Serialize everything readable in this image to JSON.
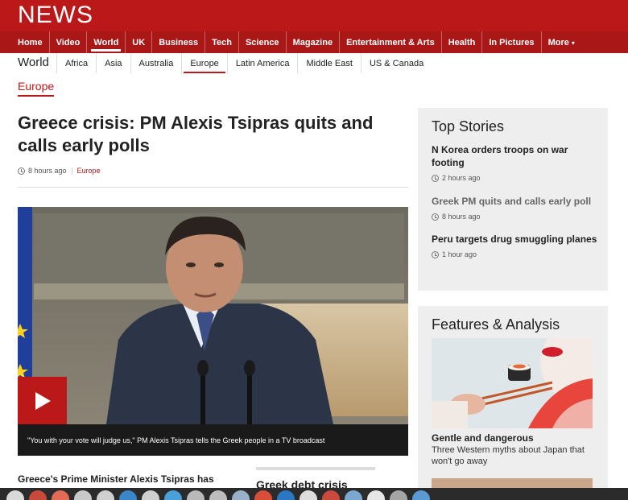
{
  "brand": {
    "logo_text": "NEWS",
    "accent": "#bb1919"
  },
  "main_nav": [
    {
      "label": "Home"
    },
    {
      "label": "Video"
    },
    {
      "label": "World",
      "active": true
    },
    {
      "label": "UK"
    },
    {
      "label": "Business"
    },
    {
      "label": "Tech"
    },
    {
      "label": "Science"
    },
    {
      "label": "Magazine"
    },
    {
      "label": "Entertainment & Arts"
    },
    {
      "label": "Health"
    },
    {
      "label": "In Pictures"
    },
    {
      "label": "More"
    }
  ],
  "sub_nav": {
    "section": "World",
    "items": [
      {
        "label": "Africa"
      },
      {
        "label": "Asia"
      },
      {
        "label": "Australia"
      },
      {
        "label": "Europe",
        "active": true
      },
      {
        "label": "Latin America"
      },
      {
        "label": "Middle East"
      },
      {
        "label": "US & Canada"
      }
    ]
  },
  "breadcrumb": "Europe",
  "article": {
    "headline": "Greece crisis: PM Alexis Tsipras quits and calls early polls",
    "time": "8 hours ago",
    "section_tag": "Europe",
    "media_caption": "\"You with your vote will judge us,\" PM Alexis Tsipras tells the Greek people in a TV broadcast",
    "lede": "Greece's Prime Minister Alexis Tsipras has",
    "related_title": "Greek debt crisis"
  },
  "top_stories": {
    "heading": "Top Stories",
    "items": [
      {
        "title": "N Korea orders troops on war footing",
        "time": "2 hours ago"
      },
      {
        "title": "Greek PM quits and calls early poll",
        "time": "8 hours ago",
        "visited": true
      },
      {
        "title": "Peru targets drug smuggling planes",
        "time": "1 hour ago"
      }
    ]
  },
  "features": {
    "heading": "Features & Analysis",
    "item_title": "Gentle and dangerous",
    "item_summary": "Three Western myths about Japan that won't go away"
  }
}
